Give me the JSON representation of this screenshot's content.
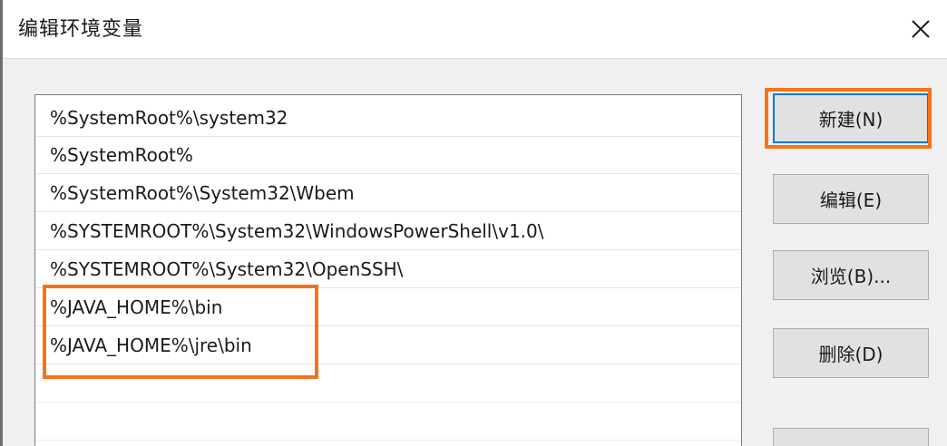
{
  "window": {
    "title": "编辑环境变量"
  },
  "path_list": {
    "items": [
      "%SystemRoot%\\system32",
      "%SystemRoot%",
      "%SystemRoot%\\System32\\Wbem",
      "%SYSTEMROOT%\\System32\\WindowsPowerShell\\v1.0\\",
      "%SYSTEMROOT%\\System32\\OpenSSH\\",
      "%JAVA_HOME%\\bin",
      "%JAVA_HOME%\\jre\\bin",
      "",
      ""
    ]
  },
  "buttons": {
    "new_label": "新建(N)",
    "edit_label": "编辑(E)",
    "browse_label": "浏览(B)...",
    "delete_label": "删除(D)"
  },
  "icons": {
    "close": "close-icon"
  },
  "colors": {
    "annotation": "#f5741a",
    "default_button_border": "#0078d7",
    "button_face": "#e1e1e1",
    "dialog_bg": "#f0f0f0"
  }
}
